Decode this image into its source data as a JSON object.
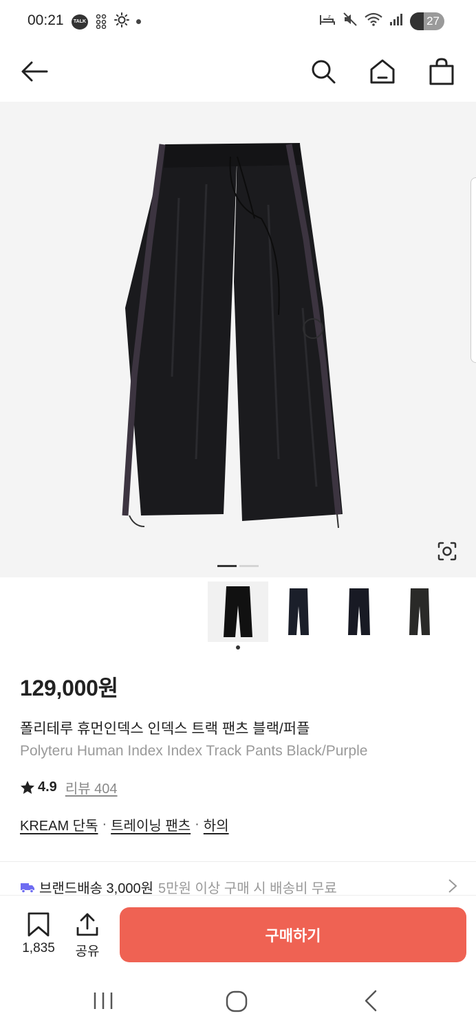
{
  "status_bar": {
    "time": "00:21",
    "talk_label": "TALK",
    "battery": "27"
  },
  "header": {
    "back_icon": "arrow-left-icon",
    "search_icon": "search-icon",
    "home_icon": "home-icon",
    "cart_icon": "shopping-bag-icon"
  },
  "gallery": {
    "thumbnail_count": 4,
    "selected_index": 0
  },
  "product": {
    "price": "129,000원",
    "name_ko": "폴리테루 휴먼인덱스 인덱스 트랙 팬츠 블랙/퍼플",
    "name_en": "Polyteru Human Index Index Track Pants Black/Purple",
    "rating": "4.9",
    "review_label": "리뷰 404",
    "categories": [
      "KREAM 단독",
      "트레이닝 팬츠",
      "하의"
    ],
    "category_separator": "·"
  },
  "shipping": {
    "main": "브랜드배송 3,000원",
    "sub": "5만원 이상 구매 시 배송비 무료",
    "icon": "truck-icon"
  },
  "actions": {
    "save_count": "1,835",
    "share_label": "공유",
    "buy_label": "구매하기"
  },
  "colors": {
    "buy_button": "#ef6253",
    "shipping_icon": "#6e6cf2"
  }
}
